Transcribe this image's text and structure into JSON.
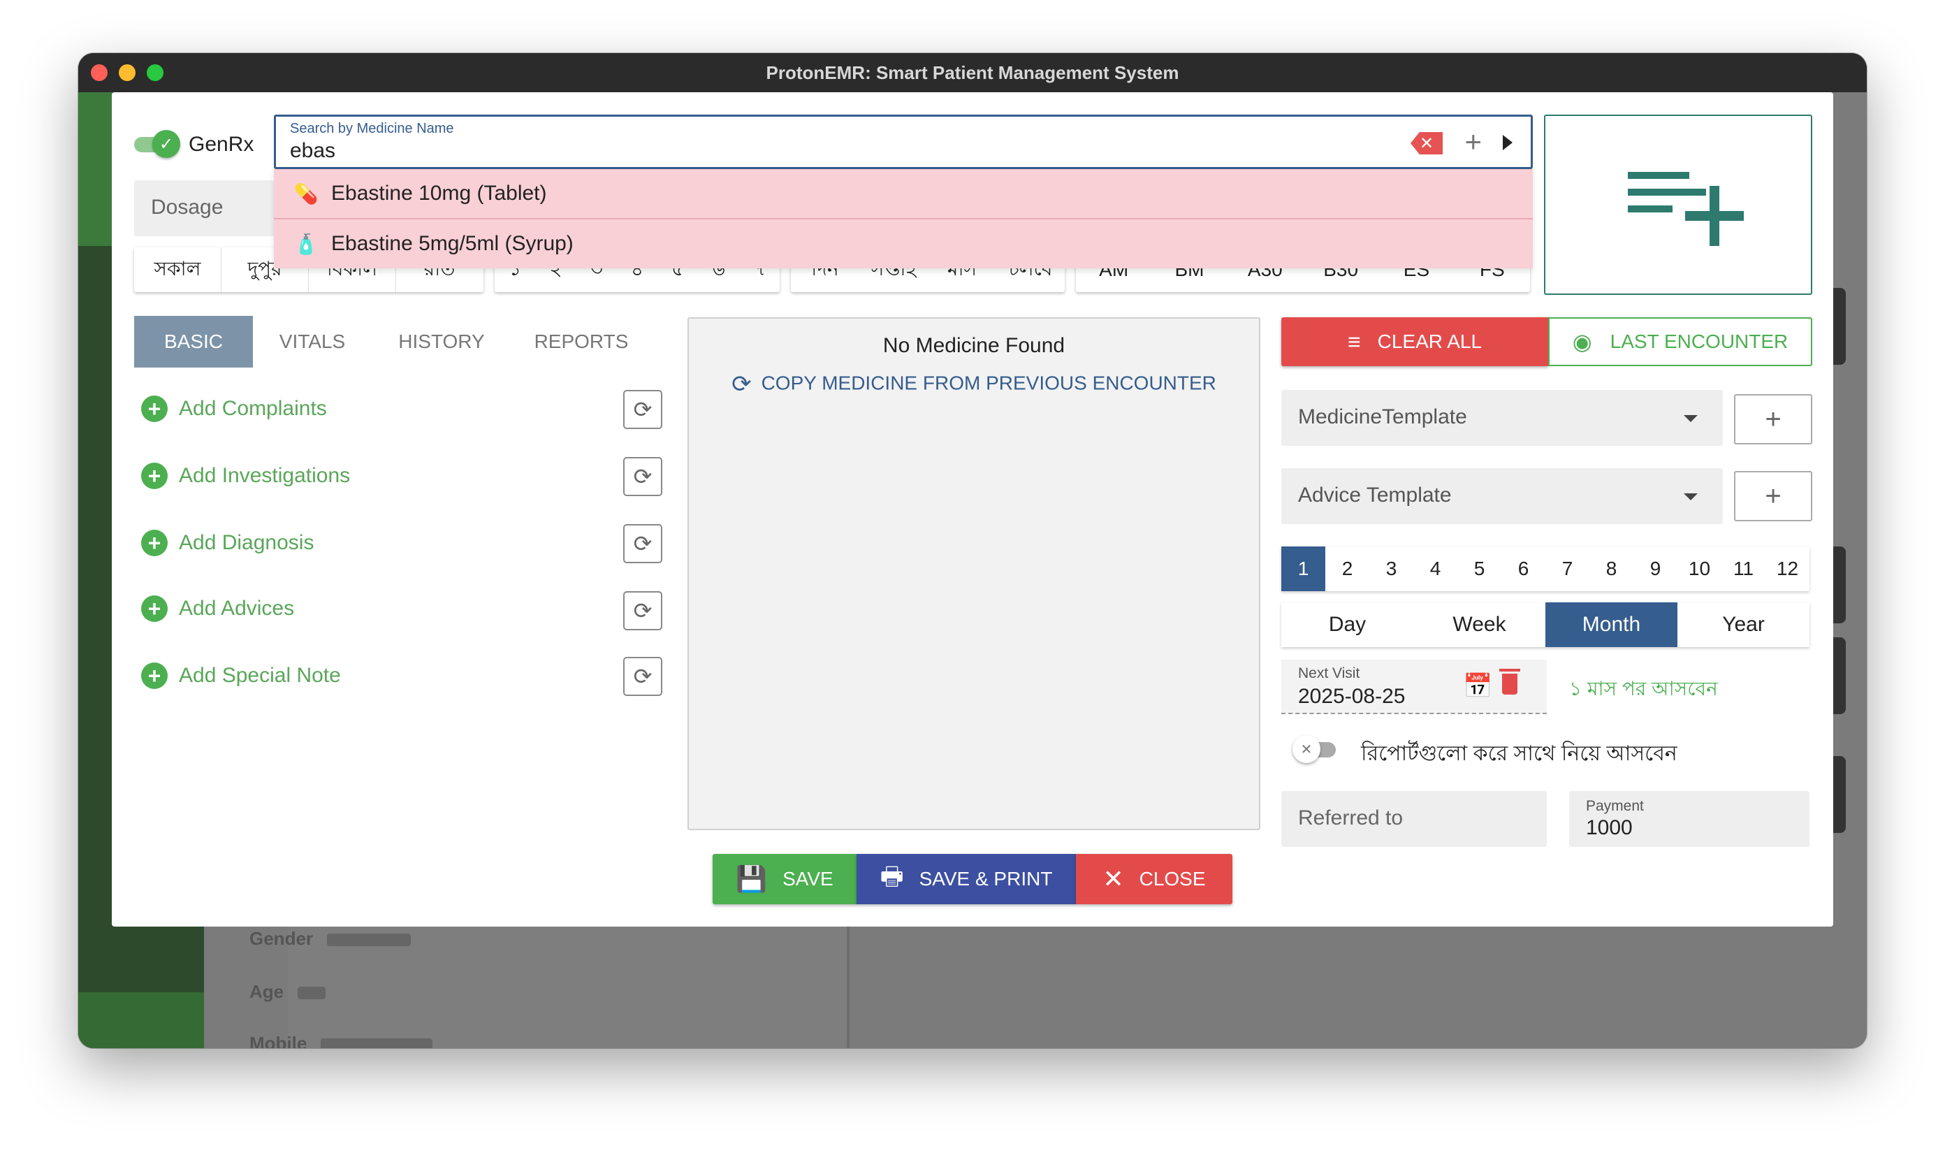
{
  "window": {
    "title": "ProtonEMR: Smart Patient Management System"
  },
  "background": {
    "rows": [
      {
        "label": "Gender"
      },
      {
        "label": "Age"
      },
      {
        "label": "Mobile"
      }
    ]
  },
  "genrx": {
    "label": "GenRx",
    "enabled": true
  },
  "search": {
    "label": "Search by Medicine Name",
    "value": "ebas",
    "suggestions": [
      {
        "label": "Ebastine 10mg (Tablet)",
        "icon": "pill-icon"
      },
      {
        "label": "Ebastine 5mg/5ml (Syrup)",
        "icon": "syrup-bottle-icon"
      }
    ]
  },
  "dosage": {
    "placeholder": "Dosage"
  },
  "chips": {
    "times": [
      "সকাল",
      "দুপুর",
      "বিকাল",
      "রাত"
    ],
    "numbers": [
      "১",
      "২",
      "৩",
      "৪",
      "৫",
      "৬",
      "৭"
    ],
    "periods": [
      "দিন",
      "সপ্তাহ",
      "মাস",
      "চলবে"
    ],
    "meal": [
      "AM",
      "BM",
      "A30",
      "B30",
      "ES",
      "FS"
    ]
  },
  "tabs": [
    {
      "label": "BASIC",
      "active": true
    },
    {
      "label": "VITALS",
      "active": false
    },
    {
      "label": "HISTORY",
      "active": false
    },
    {
      "label": "REPORTS",
      "active": false
    }
  ],
  "add_items": [
    {
      "label": "Add Complaints"
    },
    {
      "label": "Add Investigations"
    },
    {
      "label": "Add Diagnosis"
    },
    {
      "label": "Add Advices"
    },
    {
      "label": "Add Special Note"
    }
  ],
  "medicine_panel": {
    "empty_text": "No Medicine Found",
    "copy_label": "COPY MEDICINE FROM PREVIOUS ENCOUNTER"
  },
  "actions": {
    "save": "SAVE",
    "save_print": "SAVE & PRINT",
    "close": "CLOSE"
  },
  "right": {
    "clear_all": "CLEAR ALL",
    "last_encounter": "LAST ENCOUNTER",
    "medicine_template": "MedicineTemplate",
    "advice_template": "Advice Template",
    "numbers": [
      "1",
      "2",
      "3",
      "4",
      "5",
      "6",
      "7",
      "8",
      "9",
      "10",
      "11",
      "12"
    ],
    "selected_number": "1",
    "units": [
      "Day",
      "Week",
      "Month",
      "Year"
    ],
    "selected_unit": "Month",
    "next_visit_label": "Next Visit",
    "next_visit_value": "2025-08-25",
    "return_text": "১ মাস পর আসবেন",
    "report_toggle_text": "রিপোর্টগুলো করে সাথে নিয়ে আসবেন",
    "report_toggle_on": false,
    "referred_placeholder": "Referred to",
    "payment_label": "Payment",
    "payment_value": "1000"
  },
  "colors": {
    "primary": "#355d8e",
    "success": "#4caf50",
    "danger": "#e34b4b",
    "teal": "#2e7a6e",
    "dropdown_bg": "#f8d0d6"
  }
}
